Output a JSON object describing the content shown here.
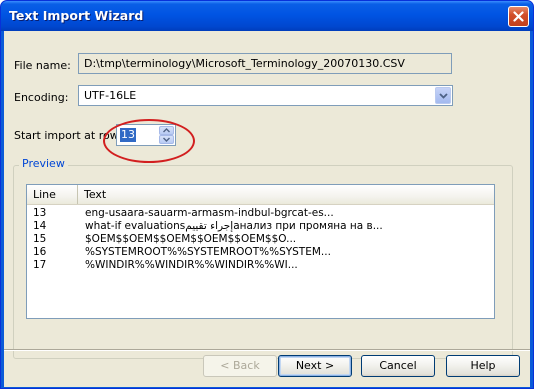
{
  "window": {
    "title": "Text Import Wizard"
  },
  "form": {
    "file_name_label": "File name:",
    "file_name_value": "D:\\tmp\\terminology\\Microsoft_Terminology_20070130.CSV",
    "encoding_label": "Encoding:",
    "encoding_value": "UTF-16LE",
    "start_row_label": "Start import at row:",
    "start_row_value": "13"
  },
  "preview": {
    "caption": "Preview",
    "columns": [
      "Line",
      "Text"
    ],
    "rows": [
      {
        "line": "13",
        "text": "eng-usaara-sauarm-armasm-indbul-bgrcat-es..."
      },
      {
        "line": "14",
        "text": "what-if evaluationsإجراء تقييمанализ при промяна на в..."
      },
      {
        "line": "15",
        "text": "$OEM$$OEM$$OEM$$OEM$$OEM$$O..."
      },
      {
        "line": "16",
        "text": "%SYSTEMROOT%%SYSTEMROOT%%SYSTEM..."
      },
      {
        "line": "17",
        "text": "%WINDIR%%WINDIR%%WINDIR%%WI..."
      }
    ]
  },
  "buttons": {
    "back": "< Back",
    "next": "Next >",
    "cancel": "Cancel",
    "help": "Help"
  },
  "colors": {
    "titlebar": "#0054e3",
    "dialog_bg": "#ece9d8",
    "highlight_annotation": "#d21f1f",
    "group_caption": "#0046d5"
  }
}
